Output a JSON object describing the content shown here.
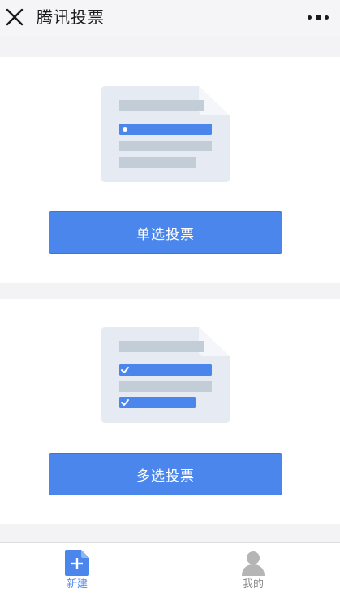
{
  "header": {
    "title": "腾讯投票",
    "close_icon": "close-icon",
    "more_icon": "more-dots-icon"
  },
  "cards": [
    {
      "illustration": "single-choice-doc-icon",
      "button_label": "单选投票"
    },
    {
      "illustration": "multi-choice-doc-icon",
      "button_label": "多选投票"
    }
  ],
  "tabbar": {
    "tabs": [
      {
        "label": "新建",
        "icon": "new-doc-icon",
        "active": true
      },
      {
        "label": "我的",
        "icon": "user-icon",
        "active": false
      }
    ]
  },
  "colors": {
    "accent": "#4a86ec",
    "page_bg": "#f3f3f5",
    "card_bg": "#ffffff",
    "illustration_bg": "#e6ebf3",
    "placeholder_bar": "#c2cdd8"
  }
}
